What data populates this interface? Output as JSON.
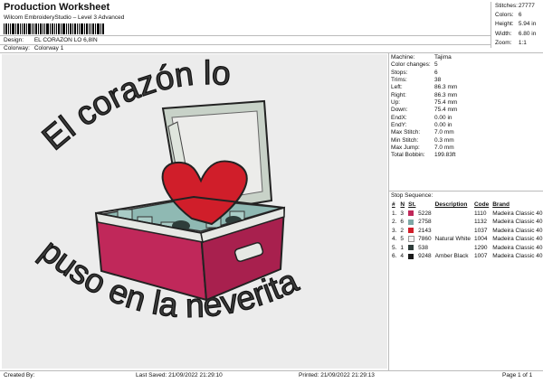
{
  "header": {
    "title": "Production Worksheet",
    "subtitle": "Wilcom EmbroideryStudio – Level 3 Advanced",
    "design_label": "Design:",
    "design_value": "EL CORAZON LO 6,8IN",
    "colorway_label": "Colorway:",
    "colorway_value": "Colorway 1"
  },
  "stats": [
    {
      "label": "Stitches:",
      "value": "27777"
    },
    {
      "label": "Colors:",
      "value": "6"
    },
    {
      "label": "Height:",
      "value": "5.94 in"
    },
    {
      "label": "Width:",
      "value": "6.80 in"
    },
    {
      "label": "Zoom:",
      "value": "1:1"
    }
  ],
  "params": [
    {
      "label": "Machine:",
      "value": "Tajima"
    },
    {
      "label": "Color changes:",
      "value": "5"
    },
    {
      "label": "Stops:",
      "value": "6"
    },
    {
      "label": "Trims:",
      "value": "38"
    },
    {
      "label": "Left:",
      "value": "86.3 mm"
    },
    {
      "label": "Right:",
      "value": "86.3 mm"
    },
    {
      "label": "Up:",
      "value": "75.4 mm"
    },
    {
      "label": "Down:",
      "value": "75.4 mm"
    },
    {
      "label": "EndX:",
      "value": "0.00 in"
    },
    {
      "label": "EndY:",
      "value": "0.00 in"
    },
    {
      "label": "Max Stitch:",
      "value": "7.0 mm"
    },
    {
      "label": "Min Stitch:",
      "value": "0.3 mm"
    },
    {
      "label": "Max Jump:",
      "value": "7.0 mm"
    },
    {
      "label": "Total Bobbin:",
      "value": "199.83ft"
    }
  ],
  "sequence": {
    "heading": "Stop Sequence:",
    "columns": [
      "#",
      "N",
      "St.",
      "Description",
      "Code",
      "Brand"
    ],
    "rows": [
      {
        "n1": "1.",
        "n2": "3",
        "color": "#c0285a",
        "st": "5228",
        "desc": "",
        "code": "1110",
        "brand": "Madeira Classic 40"
      },
      {
        "n1": "2.",
        "n2": "6",
        "color": "#7fa8a6",
        "st": "2758",
        "desc": "",
        "code": "1132",
        "brand": "Madeira Classic 40"
      },
      {
        "n1": "3.",
        "n2": "2",
        "color": "#d01e2a",
        "st": "2143",
        "desc": "",
        "code": "1037",
        "brand": "Madeira Classic 40"
      },
      {
        "n1": "4.",
        "n2": "5",
        "color": "#f4f4f4",
        "st": "7860",
        "desc": "Natural White",
        "code": "1004",
        "brand": "Madeira Classic 40"
      },
      {
        "n1": "5.",
        "n2": "1",
        "color": "#2e3d3a",
        "st": "538",
        "desc": "",
        "code": "1290",
        "brand": "Madeira Classic 40"
      },
      {
        "n1": "6.",
        "n2": "4",
        "color": "#1a1a1a",
        "st": "9248",
        "desc": "Amber Black",
        "code": "1007",
        "brand": "Madeira Classic 40"
      }
    ]
  },
  "design": {
    "text_top": "El corazón lo",
    "text_bottom": "puso en la neverita"
  },
  "footer": {
    "created_by": "Created By:",
    "last_saved": "Last Saved: 21/09/2022 21:29:10",
    "printed": "Printed: 21/09/2022 21:29:13",
    "page": "Page 1 of 1"
  }
}
